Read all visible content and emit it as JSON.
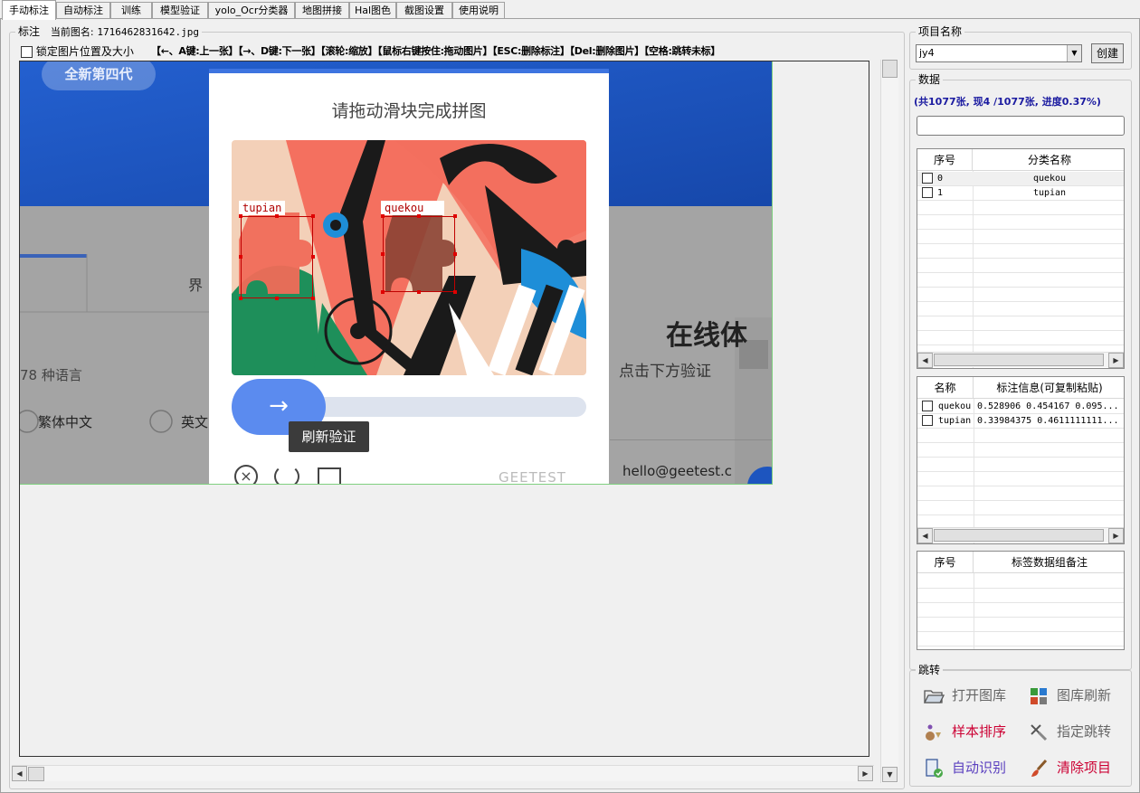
{
  "tabs": [
    "手动标注",
    "自动标注",
    "训练",
    "模型验证",
    "yolo_Ocr分类器",
    "地图拼接",
    "Hal图色",
    "截图设置",
    "使用说明"
  ],
  "annot": {
    "group_title": "标注",
    "current_image_label": "当前图名:",
    "current_image": "1716462831642.jpg",
    "lock_label": "锁定图片位置及大小",
    "shortcuts": "【←、A键:上一张】【→、D键:下一张】【滚轮:缩放】【鼠标右键按住:拖动图片】【ESC:删除标注】【Del:删除图片】【空格:跳转未标】"
  },
  "captcha": {
    "title": "请拖动滑块完成拼图",
    "box_label_1": "tupian",
    "box_label_2": "quekou",
    "tooltip": "刷新验证",
    "brand": "GEETEST",
    "bg_badge": "全新第四代",
    "bg_lang": "78 种语言",
    "bg_radio1": "繁体中文",
    "bg_radio2": "英文",
    "bg_tab": "界",
    "bg_heading": "在线体",
    "bg_sub": "点击下方验证",
    "bg_email": "hello@geetest.c"
  },
  "project": {
    "group_title": "项目名称",
    "value": "jy4",
    "create_label": "创建"
  },
  "data_panel": {
    "group_title": "数据",
    "progress": "(共1077张, 现4 /1077张, 进度0.37%)"
  },
  "class_table": {
    "headers": [
      "序号",
      "分类名称"
    ],
    "rows": [
      {
        "id": "0",
        "name": "quekou"
      },
      {
        "id": "1",
        "name": "tupian"
      }
    ]
  },
  "label_table": {
    "headers": [
      "名称",
      "标注信息(可复制粘贴)"
    ],
    "rows": [
      {
        "name": "quekou",
        "info": "0.528906 0.454167 0.095..."
      },
      {
        "name": "tupian",
        "info": "0.33984375 0.4611111111..."
      }
    ]
  },
  "remark_table": {
    "headers": [
      "序号",
      "标签数据组备注"
    ]
  },
  "jump": {
    "group_title": "跳转",
    "buttons": [
      {
        "label": "打开图库",
        "color": "#666666",
        "icon": "folder-icon"
      },
      {
        "label": "图库刷新",
        "color": "#666666",
        "icon": "grid-refresh-icon"
      },
      {
        "label": "样本排序",
        "color": "#cc0033",
        "icon": "sort-icon"
      },
      {
        "label": "指定跳转",
        "color": "#666666",
        "icon": "jump-icon"
      },
      {
        "label": "自动识别",
        "color": "#5a3fbf",
        "icon": "auto-detect-icon"
      },
      {
        "label": "清除项目",
        "color": "#cc0033",
        "icon": "brush-icon"
      }
    ]
  }
}
